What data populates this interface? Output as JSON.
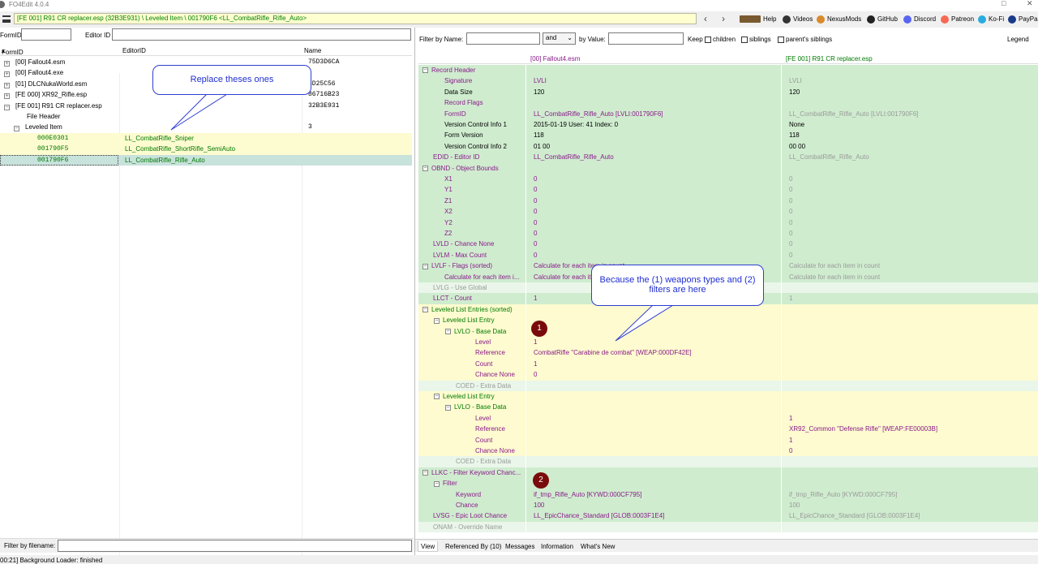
{
  "window": {
    "title": "FO4Edit 4.0.4"
  },
  "pathbar": {
    "path": "[FE 001] R91 CR replacer.esp (32B3E931) \\ Leveled Item \\ 001790F6 <LL_CombatRifle_Rifle_Auto>"
  },
  "toolbar": {
    "items": [
      "Help",
      "Videos",
      "NexusMods",
      "GitHub",
      "Discord",
      "Patreon",
      "Ko-Fi",
      "PayPal"
    ]
  },
  "leftpane": {
    "formid_label": "FormID",
    "editorid_label": "Editor ID",
    "columns": [
      "FormID",
      "EditorID",
      "Name"
    ],
    "rows": [
      {
        "c1": "[00] Fallout4.esm",
        "c2": "",
        "c3": "75D3D6CA",
        "exp": "+",
        "indent": 0
      },
      {
        "c1": "[00] Fallout4.exe",
        "c2": "",
        "c3": "",
        "exp": "+",
        "indent": 0
      },
      {
        "c1": "[01] DLCNukaWorld.esm",
        "c2": "",
        "c3": "3D25C56",
        "exp": "+",
        "indent": 0
      },
      {
        "c1": "[FE 000] XR92_Rifle.esp",
        "c2": "",
        "c3": "86716B23",
        "exp": "+",
        "indent": 0
      },
      {
        "c1": "[FE 001] R91 CR replacer.esp",
        "c2": "",
        "c3": "32B3E931",
        "exp": "-",
        "indent": 0
      },
      {
        "c1": "File Header",
        "c2": "",
        "c3": "",
        "exp": "",
        "indent": 1
      },
      {
        "c1": "Leveled Item",
        "c2": "",
        "c3": "3",
        "exp": "-",
        "indent": 1
      },
      {
        "c1": "000E0301",
        "c2": "LL_CombatRifle_Sniper",
        "c3": "",
        "exp": "",
        "indent": 2,
        "hl": "yellow"
      },
      {
        "c1": "001790F5",
        "c2": "LL_CombatRifle_ShortRifle_SemiAuto",
        "c3": "",
        "exp": "",
        "indent": 2,
        "hl": "yellow"
      },
      {
        "c1": "001790F6",
        "c2": "LL_CombatRifle_Rifle_Auto",
        "c3": "",
        "exp": "",
        "indent": 2,
        "hl": "teal"
      }
    ],
    "filter_filename_label": "Filter by filename:"
  },
  "status": {
    "text": "00:21] Background Loader: finished"
  },
  "filters": {
    "filter_by_name": "Filter by Name:",
    "op": "and",
    "by_value": "by Value:",
    "keep": "Keep",
    "children": "children",
    "siblings": "siblings",
    "parents_siblings": "parent's siblings",
    "legend": "Legend"
  },
  "grid": {
    "col_headers": [
      "",
      "[00] Fallout4.esm",
      "[FE 001] R91 CR replacer.esp"
    ],
    "rows": [
      {
        "l": "Record Header",
        "ind": 0,
        "exp": "-",
        "v1": "",
        "v2": "",
        "lc": "pur",
        "c1": "pur",
        "c2": "gry",
        "bg": "#cfeccf"
      },
      {
        "l": "Signature",
        "ind": 1,
        "v1": "LVLI",
        "v2": "LVLI",
        "lc": "pur",
        "c1": "pur",
        "c2": "gry",
        "bg": "#cfeccf"
      },
      {
        "l": "Data Size",
        "ind": 1,
        "v1": "120",
        "v2": "120",
        "lc": "blk",
        "c1": "blk",
        "c2": "blk",
        "bg": "#cfeccf"
      },
      {
        "l": "Record Flags",
        "ind": 1,
        "v1": "",
        "v2": "",
        "lc": "pur",
        "c1": "pur",
        "c2": "gry",
        "bg": "#cfeccf"
      },
      {
        "l": "FormID",
        "ind": 1,
        "v1": "LL_CombatRifle_Rifle_Auto [LVLI:001790F6]",
        "v2": "LL_CombatRifle_Rifle_Auto [LVLI:001790F6]",
        "lc": "pur",
        "c1": "pur",
        "c2": "gry",
        "bg": "#cfeccf"
      },
      {
        "l": "Version Control Info 1",
        "ind": 1,
        "v1": "2015-01-19 User: 41 Index: 0",
        "v2": "None",
        "lc": "blk",
        "c1": "blk",
        "c2": "blk",
        "bg": "#cfeccf"
      },
      {
        "l": "Form Version",
        "ind": 1,
        "v1": "118",
        "v2": "118",
        "lc": "blk",
        "c1": "blk",
        "c2": "blk",
        "bg": "#cfeccf"
      },
      {
        "l": "Version Control Info 2",
        "ind": 1,
        "v1": "01 00",
        "v2": "00 00",
        "lc": "blk",
        "c1": "blk",
        "c2": "blk",
        "bg": "#cfeccf"
      },
      {
        "l": "EDID - Editor ID",
        "ind": 0,
        "v1": "LL_CombatRifle_Rifle_Auto",
        "v2": "LL_CombatRifle_Rifle_Auto",
        "lc": "pur",
        "c1": "pur",
        "c2": "gry",
        "bg": "#cfeccf"
      },
      {
        "l": "OBND - Object Bounds",
        "ind": 0,
        "exp": "-",
        "v1": "",
        "v2": "",
        "lc": "pur",
        "c1": "pur",
        "c2": "gry",
        "bg": "#cfeccf"
      },
      {
        "l": "X1",
        "ind": 1,
        "v1": "0",
        "v2": "0",
        "lc": "pur",
        "c1": "pur",
        "c2": "gry",
        "bg": "#cfeccf"
      },
      {
        "l": "Y1",
        "ind": 1,
        "v1": "0",
        "v2": "0",
        "lc": "pur",
        "c1": "pur",
        "c2": "gry",
        "bg": "#cfeccf"
      },
      {
        "l": "Z1",
        "ind": 1,
        "v1": "0",
        "v2": "0",
        "lc": "pur",
        "c1": "pur",
        "c2": "gry",
        "bg": "#cfeccf"
      },
      {
        "l": "X2",
        "ind": 1,
        "v1": "0",
        "v2": "0",
        "lc": "pur",
        "c1": "pur",
        "c2": "gry",
        "bg": "#cfeccf"
      },
      {
        "l": "Y2",
        "ind": 1,
        "v1": "0",
        "v2": "0",
        "lc": "pur",
        "c1": "pur",
        "c2": "gry",
        "bg": "#cfeccf"
      },
      {
        "l": "Z2",
        "ind": 1,
        "v1": "0",
        "v2": "0",
        "lc": "pur",
        "c1": "pur",
        "c2": "gry",
        "bg": "#cfeccf"
      },
      {
        "l": "LVLD - Chance None",
        "ind": 0,
        "v1": "0",
        "v2": "0",
        "lc": "pur",
        "c1": "pur",
        "c2": "gry",
        "bg": "#cfeccf"
      },
      {
        "l": "LVLM - Max Count",
        "ind": 0,
        "v1": "0",
        "v2": "0",
        "lc": "pur",
        "c1": "pur",
        "c2": "gry",
        "bg": "#cfeccf"
      },
      {
        "l": "LVLF - Flags (sorted)",
        "ind": 0,
        "exp": "-",
        "v1": "Calculate for each item in count",
        "v2": "Calculate for each item in count",
        "lc": "pur",
        "c1": "pur",
        "c2": "gry",
        "bg": "#cfeccf"
      },
      {
        "l": "Calculate for each item i...",
        "ind": 1,
        "v1": "Calculate for each item in count",
        "v2": "Calculate for each item in count",
        "lc": "pur",
        "c1": "pur",
        "c2": "gry",
        "bg": "#cfeccf"
      },
      {
        "l": "LVLG - Use Global",
        "ind": 0,
        "v1": "",
        "v2": "",
        "lc": "gry",
        "c1": "gry",
        "c2": "gry",
        "bg": "#e9f6e9"
      },
      {
        "l": "LLCT - Count",
        "ind": 0,
        "v1": "1",
        "v2": "1",
        "lc": "pur",
        "c1": "pur",
        "c2": "gry",
        "bg": "#cfeccf"
      },
      {
        "l": "Leveled List Entries (sorted)",
        "ind": 0,
        "exp": "-",
        "v1": "",
        "v2": "",
        "lc": "grn",
        "c1": "grn",
        "c2": "grn",
        "bg": "#fdfbcf"
      },
      {
        "l": "Leveled List Entry",
        "ind": 1,
        "exp": "-",
        "v1": "",
        "v2": "",
        "lc": "grn",
        "c1": "grn",
        "c2": "grn",
        "bg": "#fdfbcf"
      },
      {
        "l": "LVLO - Base Data",
        "ind": 2,
        "exp": "-",
        "v1": "",
        "v2": "",
        "lc": "grn",
        "c1": "grn",
        "c2": "grn",
        "bg": "#fdfbcf"
      },
      {
        "l": "Level",
        "ind": 3,
        "v1": "1",
        "v2": "",
        "lc": "pur",
        "c1": "pur",
        "c2": "pur",
        "bg": "#fdfbcf"
      },
      {
        "l": "Reference",
        "ind": 3,
        "v1": "CombatRifle \"Carabine de combat\" [WEAP:000DF42E]",
        "v2": "",
        "lc": "pur",
        "c1": "pur",
        "c2": "pur",
        "bg": "#fdfbcf"
      },
      {
        "l": "Count",
        "ind": 3,
        "v1": "1",
        "v2": "",
        "lc": "pur",
        "c1": "pur",
        "c2": "pur",
        "bg": "#fdfbcf"
      },
      {
        "l": "Chance None",
        "ind": 3,
        "v1": "0",
        "v2": "",
        "lc": "pur",
        "c1": "pur",
        "c2": "pur",
        "bg": "#fdfbcf"
      },
      {
        "l": "COED - Extra Data",
        "ind": 2,
        "v1": "",
        "v2": "",
        "lc": "gry",
        "c1": "gry",
        "c2": "gry",
        "bg": "#e9f6e9"
      },
      {
        "l": "Leveled List Entry",
        "ind": 1,
        "exp": "-",
        "v1": "",
        "v2": "",
        "lc": "grn",
        "c1": "grn",
        "c2": "grn",
        "bg": "#fdfbcf"
      },
      {
        "l": "LVLO - Base Data",
        "ind": 2,
        "exp": "-",
        "v1": "",
        "v2": "",
        "lc": "grn",
        "c1": "grn",
        "c2": "grn",
        "bg": "#fdfbcf"
      },
      {
        "l": "Level",
        "ind": 3,
        "v1": "",
        "v2": "1",
        "lc": "pur",
        "c1": "pur",
        "c2": "pur",
        "bg": "#fdfbcf"
      },
      {
        "l": "Reference",
        "ind": 3,
        "v1": "",
        "v2": "XR92_Common \"Defense Rifle\" [WEAP:FE00003B]",
        "lc": "pur",
        "c1": "pur",
        "c2": "pur",
        "bg": "#fdfbcf"
      },
      {
        "l": "Count",
        "ind": 3,
        "v1": "",
        "v2": "1",
        "lc": "pur",
        "c1": "pur",
        "c2": "pur",
        "bg": "#fdfbcf"
      },
      {
        "l": "Chance None",
        "ind": 3,
        "v1": "",
        "v2": "0",
        "lc": "pur",
        "c1": "pur",
        "c2": "pur",
        "bg": "#fdfbcf"
      },
      {
        "l": "COED - Extra Data",
        "ind": 2,
        "v1": "",
        "v2": "",
        "lc": "gry",
        "c1": "gry",
        "c2": "gry",
        "bg": "#e9f6e9"
      },
      {
        "l": "LLKC - Filter Keyword Chanc...",
        "ind": 0,
        "exp": "-",
        "v1": "",
        "v2": "",
        "lc": "pur",
        "c1": "pur",
        "c2": "gry",
        "bg": "#cfeccf"
      },
      {
        "l": "Filter",
        "ind": 1,
        "exp": "-",
        "v1": "",
        "v2": "",
        "lc": "pur",
        "c1": "pur",
        "c2": "gry",
        "bg": "#cfeccf"
      },
      {
        "l": "Keyword",
        "ind": 2,
        "v1": "if_tmp_Rifle_Auto [KYWD:000CF795]",
        "v2": "if_tmp_Rifle_Auto [KYWD:000CF795]",
        "lc": "pur",
        "c1": "pur",
        "c2": "gry",
        "bg": "#cfeccf"
      },
      {
        "l": "Chance",
        "ind": 2,
        "v1": "100",
        "v2": "100",
        "lc": "pur",
        "c1": "pur",
        "c2": "gry",
        "bg": "#cfeccf"
      },
      {
        "l": "LVSG - Epic Loot Chance",
        "ind": 0,
        "v1": "LL_EpicChance_Standard [GLOB:0003F1E4]",
        "v2": "LL_EpicChance_Standard [GLOB:0003F1E4]",
        "lc": "pur",
        "c1": "pur",
        "c2": "gry",
        "bg": "#cfeccf"
      },
      {
        "l": "ONAM - Override Name",
        "ind": 0,
        "v1": "",
        "v2": "",
        "lc": "gry",
        "c1": "gry",
        "c2": "gry",
        "bg": "#e9f6e9"
      }
    ]
  },
  "tabs": [
    "View",
    "Referenced By (10)",
    "Messages",
    "Information",
    "What's New"
  ],
  "annotations": {
    "callout1": "Replace theses ones",
    "callout2": "Because the (1) weapons types and (2) filters are here",
    "badge1": "1",
    "badge2": "2"
  }
}
